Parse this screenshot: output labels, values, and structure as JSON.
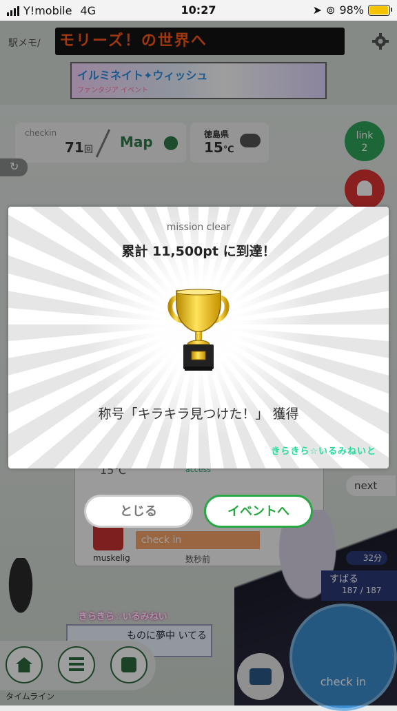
{
  "status_bar": {
    "carrier": "Y!mobile",
    "network": "4G",
    "time": "10:27",
    "battery_percent_label": "98%",
    "battery_level": 0.98,
    "battery_color": "#f5c400"
  },
  "game": {
    "station_memo": "駅メモ/",
    "ticker_text": "モリーズ！の世界へ",
    "banner": {
      "title": "イルミネイト✦ウィッシュ",
      "subtitle": "ファンタジア イベント"
    },
    "checkin_card": {
      "label": "checkin",
      "count": "71",
      "unit": "回",
      "map_label": "Map"
    },
    "weather": {
      "prefecture": "徳島県",
      "temperature": "15",
      "unit": "℃"
    },
    "link_button": {
      "line1": "link",
      "line2": "2"
    },
    "background_panel": {
      "temperature": "15℃",
      "access_label": "access",
      "tag_text": "check in",
      "username": "muskelig",
      "time_ago": "数秒前"
    },
    "next_label": "next",
    "timer_label": "32分",
    "character": {
      "name": "すばる",
      "hp": "187 / 187"
    },
    "timeline_label": "タイムライン",
    "checkin_button_label": "check in",
    "bg_logo": "きらきら☆いるみねいと",
    "bg_message": "ものに夢中 いてる"
  },
  "dialog": {
    "kicker": "mission clear",
    "title": "累計 11,500pt に到達！",
    "reward": "称号「キラキラ見つけた！」 獲得",
    "logo": "きらきら☆いるみねいと",
    "close_label": "とじる",
    "event_label": "イベントへ",
    "accent_color": "#28a745"
  },
  "icons": [
    "signal-bars-icon",
    "location-arrow-icon",
    "orientation-lock-icon",
    "battery-icon",
    "gear-icon",
    "map-pin-icon",
    "cloud-icon",
    "bell-icon",
    "refresh-icon",
    "trophy-icon",
    "home-icon",
    "list-icon",
    "train-icon",
    "briefcase-icon"
  ]
}
